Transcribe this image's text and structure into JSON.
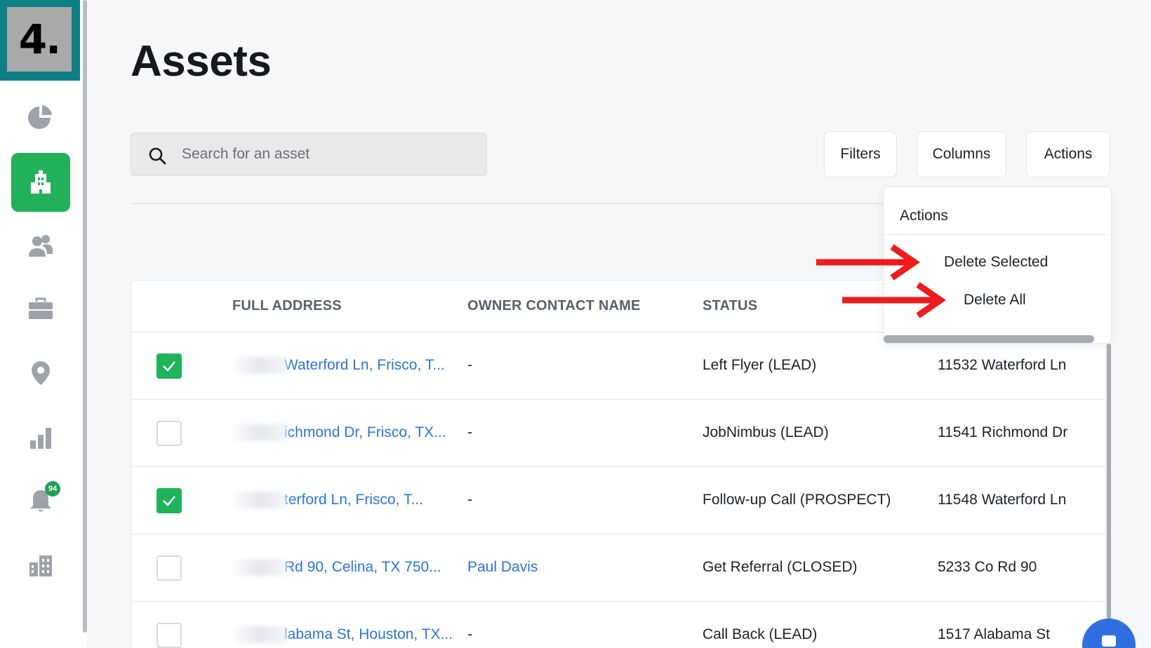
{
  "step_badge": "4.",
  "sidebar": {
    "items": [
      {
        "icon": "pie-chart-icon"
      },
      {
        "icon": "building-icon",
        "active": true
      },
      {
        "icon": "contacts-icon"
      },
      {
        "icon": "briefcase-icon"
      },
      {
        "icon": "map-pin-icon"
      },
      {
        "icon": "bar-chart-icon"
      },
      {
        "icon": "bell-icon",
        "badge": "94"
      },
      {
        "icon": "city-icon"
      }
    ]
  },
  "page": {
    "title": "Assets"
  },
  "search": {
    "placeholder": "Search for an asset"
  },
  "toolbar": {
    "filters_label": "Filters",
    "columns_label": "Columns",
    "actions_label": "Actions"
  },
  "actions_menu": {
    "title": "Actions",
    "items": [
      "Delete Selected",
      "Delete All"
    ]
  },
  "table": {
    "headers": [
      "FULL ADDRESS",
      "OWNER CONTACT NAME",
      "STATUS"
    ],
    "rows": [
      {
        "checked": true,
        "address": "Waterford Ln, Frisco, T...",
        "owner": "-",
        "status": "Left Flyer (LEAD)",
        "street": "11532 Waterford Ln"
      },
      {
        "checked": false,
        "address": "ichmond Dr, Frisco, TX...",
        "owner": "-",
        "status": "JobNimbus (LEAD)",
        "street": "11541 Richmond Dr"
      },
      {
        "checked": true,
        "address": "terford Ln, Frisco, T...",
        "owner": "-",
        "status": "Follow-up Call (PROSPECT)",
        "street": "11548 Waterford Ln"
      },
      {
        "checked": false,
        "address": "Rd 90, Celina, TX 750...",
        "owner": "Paul Davis",
        "status": "Get Referral (CLOSED)",
        "street": "5233 Co Rd 90"
      },
      {
        "checked": false,
        "address": "labama St, Houston, TX...",
        "owner": "-",
        "status": "Call Back (LEAD)",
        "street": "1517 Alabama St"
      }
    ]
  },
  "colors": {
    "accent_green": "#22b15a",
    "link_blue": "#2c74d6",
    "annotation_red": "#ee1c1c",
    "badge_teal": "#0f7f86"
  }
}
